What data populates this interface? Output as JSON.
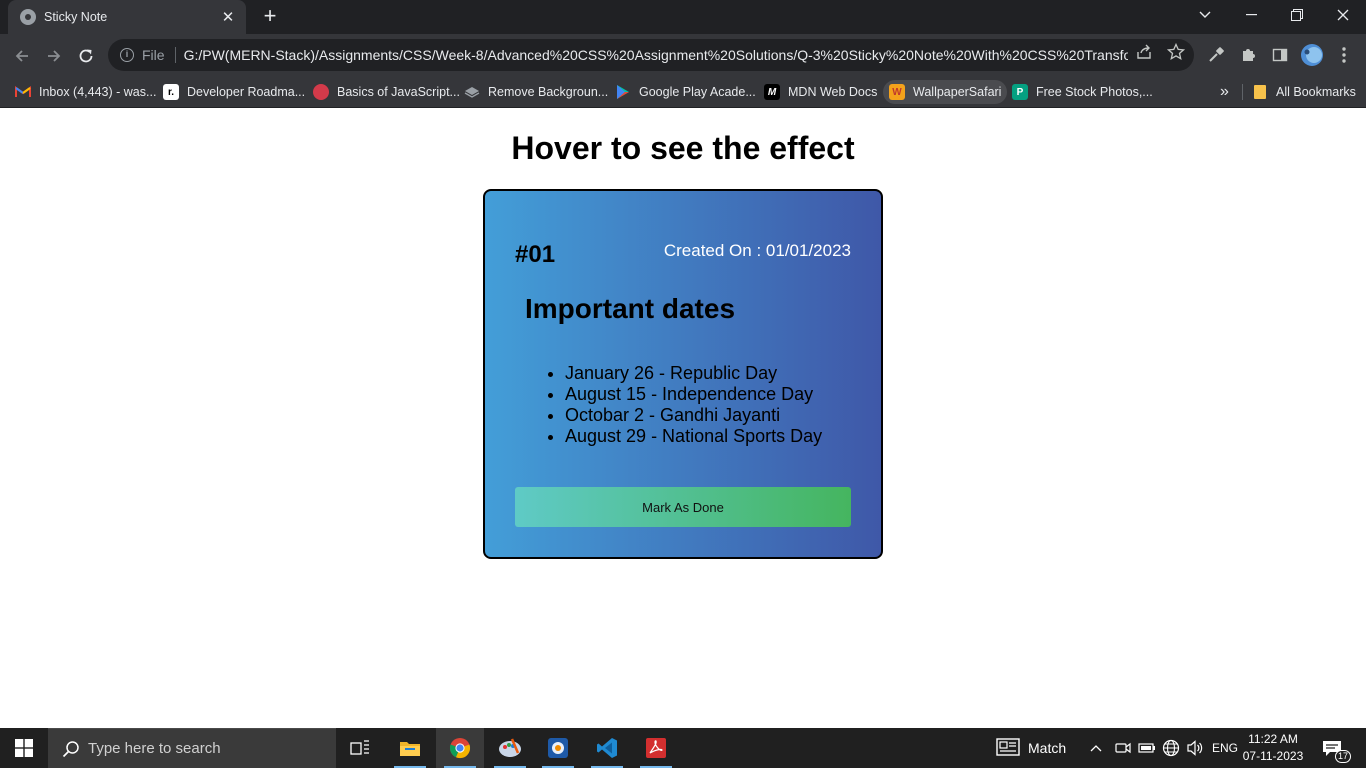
{
  "browser": {
    "tab_title": "Sticky Note",
    "tab_close": "✕",
    "new_tab": "+",
    "address": {
      "scheme_label": "File",
      "url": "G:/PW(MERN-Stack)/Assignments/CSS/Week-8/Advanced%20CSS%20Assignment%20Solutions/Q-3%20Sticky%20Note%20With%20CSS%20Transform..."
    },
    "bookmarks": [
      {
        "label": "Inbox (4,443) - was...",
        "icon": "gmail-icon"
      },
      {
        "label": "Developer Roadma...",
        "icon": "roadmap-icon"
      },
      {
        "label": "Basics of JavaScript...",
        "icon": "js-basics-icon"
      },
      {
        "label": "Remove Backgroun...",
        "icon": "remove-bg-icon"
      },
      {
        "label": "Google Play Acade...",
        "icon": "google-play-icon"
      },
      {
        "label": "MDN Web Docs",
        "icon": "mdn-icon"
      },
      {
        "label": "WallpaperSafari",
        "icon": "wallpapersafari-icon"
      },
      {
        "label": "Free Stock Photos,...",
        "icon": "stock-photos-icon"
      }
    ],
    "bookmarks_overflow": "»",
    "all_bookmarks": "All Bookmarks"
  },
  "page": {
    "heading": "Hover to see the effect",
    "note": {
      "number": "#01",
      "created": "Created On : 01/01/2023",
      "title": "Important dates",
      "items": [
        "January 26 - Republic Day",
        "August 15 - Independence Day",
        "Octobar 2 - Gandhi Jayanti",
        "August 29 - National Sports Day"
      ],
      "button_label": "Mark As Done"
    }
  },
  "taskbar": {
    "search_placeholder": "Type here to search",
    "weather_label": "Match",
    "language": "ENG",
    "time": "11:22 AM",
    "date": "07-11-2023",
    "notification_count": "17"
  },
  "colors": {
    "note_gradient_start": "#439ed8",
    "note_gradient_end": "#3f58a8",
    "button_gradient_start": "#5fcac6",
    "button_gradient_end": "#45b55f",
    "browser_dark": "#202124",
    "browser_toolbar": "#35363a"
  }
}
